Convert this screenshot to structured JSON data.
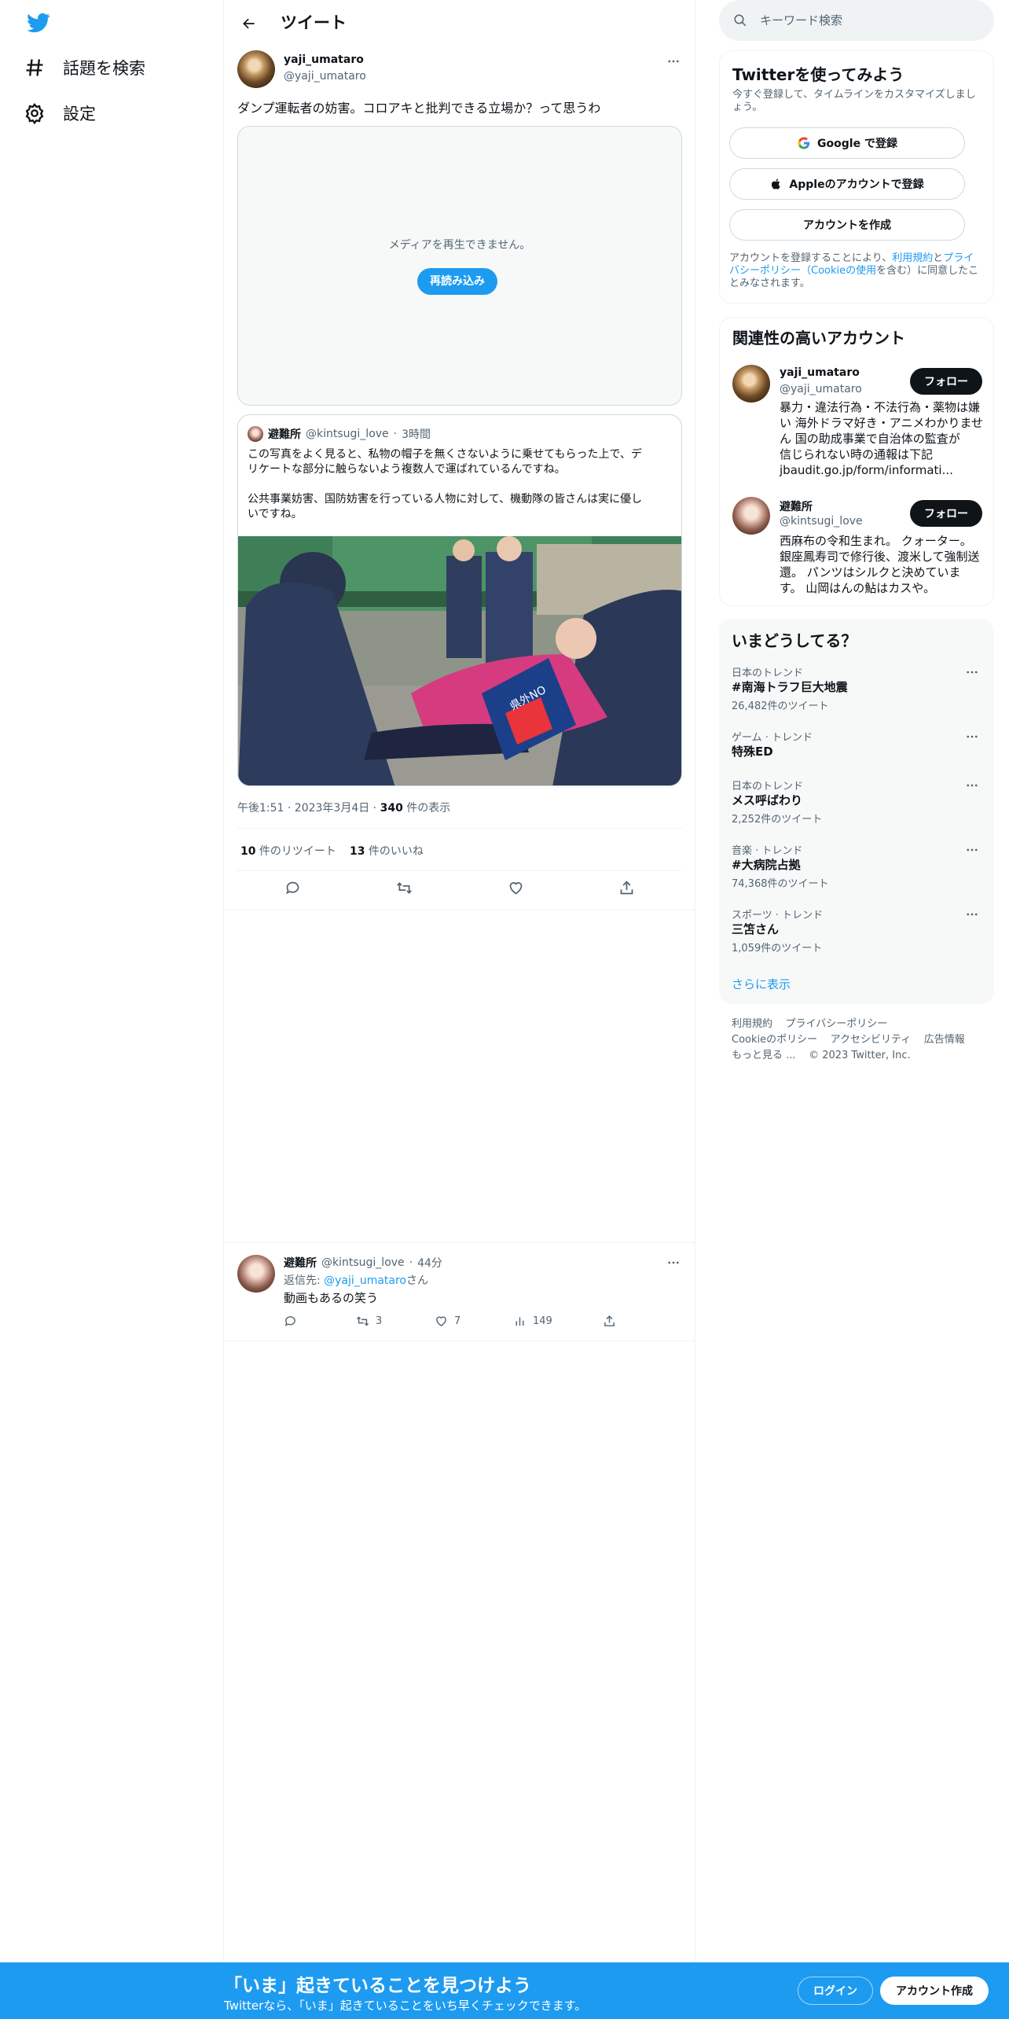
{
  "nav": {
    "explore_label": "話題を検索",
    "settings_label": "設定"
  },
  "header": {
    "title": "ツイート"
  },
  "tweet": {
    "author_name": "yaji_umataro",
    "author_handle": "@yaji_umataro",
    "text": "ダンプ運転者の妨害。コロアキと批判できる立場か？って思うわ",
    "media_error": "メディアを再生できません。",
    "reload_label": "再読み込み",
    "quote": {
      "author_name": "避難所",
      "author_handle": "@kintsugi_love",
      "time": "3時間",
      "lines": [
        "この写真をよく見ると、私物の帽子を無くさないように乗せてもらった上で、デ",
        "リケートな部分に触らないよう複数人で運ばれているんですね。",
        "",
        "公共事業妨害、国防妨害を行っている人物に対して、機動隊の皆さんは実に優し",
        "いですね。"
      ],
      "sign_text": "県外NO"
    },
    "timestamp": "午後1:51 · 2023年3月4日 · ",
    "views_count": "340",
    "views_label": " 件の表示",
    "retweets_count": "10",
    "retweets_label": " 件のリツイート",
    "likes_count": "13",
    "likes_label": " 件のいいね"
  },
  "reply": {
    "author_name": "避難所",
    "author_handle": "@kintsugi_love",
    "time": "44分",
    "reply_to_prefix": "返信先: ",
    "reply_to_handle": "@yaji_umataro",
    "reply_to_suffix": "さん",
    "text": "動画もあるの笑う",
    "retweets": "3",
    "likes": "7",
    "views": "149"
  },
  "search": {
    "placeholder": "キーワード検索"
  },
  "signup": {
    "title": "Twitterを使ってみよう",
    "subtitle_1": "今すぐ登録して、タイムラインをカスタマイズしまし",
    "subtitle_2": "ょう。",
    "google_label": "Google で登録",
    "apple_label": "Appleのアカウントで登録",
    "create_label": "アカウントを作成",
    "terms_1a": "アカウントを登録することにより、",
    "terms_1b": "利用規約",
    "terms_1c": "と",
    "terms_1d": "プライ",
    "terms_2a": "バシーポリシー（",
    "terms_2b": "Cookieの使用",
    "terms_2c": "を含む）に同意したこ",
    "terms_3": "とみなされます。"
  },
  "related": {
    "title": "関連性の高いアカウント",
    "follow_label": "フォロー",
    "accounts": [
      {
        "name": "yaji_umataro",
        "handle": "@yaji_umataro",
        "bio": [
          "暴力・違法行為・不法行為・薬物は嫌",
          "い 海外ドラマ好き・アニメわかりませ",
          "ん 国の助成事業で自治体の監査が",
          "信じられない時の通報は下記"
        ],
        "link": "jbaudit.go.jp/form/informati..."
      },
      {
        "name": "避難所",
        "handle": "@kintsugi_love",
        "bio": [
          "西麻布の令和生まれ。 クォーター。",
          "銀座鳳寿司で修行後、渡米して強制送",
          "還。 パンツはシルクと決めていま",
          "す。 山岡はんの鮎はカスや。"
        ]
      }
    ]
  },
  "trends": {
    "title": "いまどうしてる？",
    "items": [
      {
        "context": "日本のトレンド",
        "name": "#南海トラフ巨大地震",
        "count": "26,482件のツイート"
      },
      {
        "context": "ゲーム · トレンド",
        "name": "特殊ED",
        "count": ""
      },
      {
        "context": "日本のトレンド",
        "name": "メス呼ばわり",
        "count": "2,252件のツイート"
      },
      {
        "context": "音楽 · トレンド",
        "name": "#大病院占拠",
        "count": "74,368件のツイート"
      },
      {
        "context": "スポーツ · トレンド",
        "name": "三笘さん",
        "count": "1,059件のツイート"
      }
    ],
    "show_more": "さらに表示"
  },
  "footer": {
    "terms": "利用規約",
    "privacy": "プライバシーポリシー",
    "cookie": "Cookieのポリシー",
    "accessibility": "アクセシビリティ",
    "ads": "広告情報",
    "more": "もっと見る ...",
    "copyright": "© 2023 Twitter, Inc."
  },
  "bottom": {
    "title": "「いま」起きていることを見つけよう",
    "subtitle": "Twitterなら、「いま」起きていることをいち早くチェックできます。",
    "login": "ログイン",
    "signup": "アカウント作成"
  },
  "colors": {
    "brand": "#1d9bf0",
    "text": "#0f1419",
    "muted": "#536471"
  }
}
